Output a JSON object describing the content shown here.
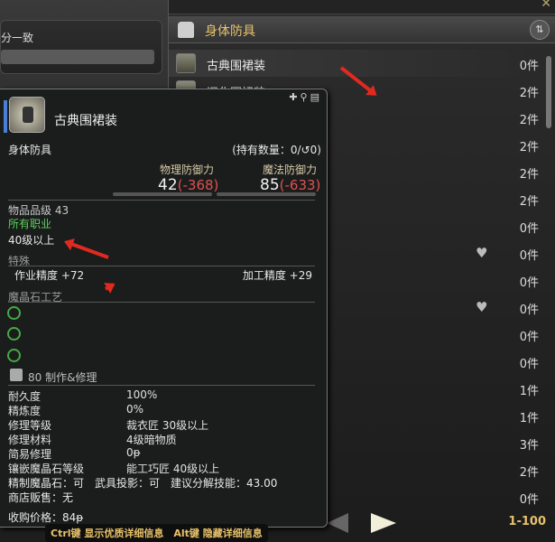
{
  "left_panel": {
    "filter_label": "分一致"
  },
  "list_header": {
    "category": "身体防具"
  },
  "items": [
    {
      "name": "古典围裙装",
      "qty": "0件",
      "heart": false
    },
    {
      "name": "旧化围裙装",
      "qty": "2件",
      "heart": false
    },
    {
      "name": "",
      "qty": "2件",
      "heart": false
    },
    {
      "name": "",
      "qty": "2件",
      "heart": false
    },
    {
      "name": "",
      "qty": "2件",
      "heart": false
    },
    {
      "name": "",
      "qty": "2件",
      "heart": false
    },
    {
      "name": "",
      "qty": "0件",
      "heart": false
    },
    {
      "name": "",
      "qty": "0件",
      "heart": true
    },
    {
      "name": "",
      "qty": "0件",
      "heart": false
    },
    {
      "name": "",
      "qty": "0件",
      "heart": true
    },
    {
      "name": "",
      "qty": "0件",
      "heart": false
    },
    {
      "name": "",
      "qty": "0件",
      "heart": false
    },
    {
      "name": "",
      "qty": "1件",
      "heart": false
    },
    {
      "name": "",
      "qty": "1件",
      "heart": false
    },
    {
      "name": "",
      "qty": "3件",
      "heart": false
    },
    {
      "name": "",
      "qty": "2件",
      "heart": false
    },
    {
      "name": "",
      "qty": "0件",
      "heart": false
    }
  ],
  "footer": {
    "page_range": "1-100"
  },
  "tooltip": {
    "name": "古典围裙装",
    "category": "身体防具",
    "owned": "(持有数量：0/",
    "owned_hq": "0)",
    "phys_def_label": "物理防御力",
    "phys_def": "42",
    "phys_def_diff": "(-368)",
    "mag_def_label": "魔法防御力",
    "mag_def": "85",
    "mag_def_diff": "(-633)",
    "item_level": "物品品级 43",
    "jobs": "所有职业",
    "level_req": "40级以上",
    "special_header": "特殊",
    "craftsmanship": "作业精度 +72",
    "control": "加工精度 +29",
    "materia_header": "魔晶石工艺",
    "repair_header": "80 制作&修理",
    "details": [
      {
        "k": "耐久度",
        "v": "100%"
      },
      {
        "k": "精炼度",
        "v": "0%"
      },
      {
        "k": "修理等级",
        "v": "裁衣匠 30级以上"
      },
      {
        "k": "修理材料",
        "v": "4级暗物质"
      },
      {
        "k": "简易修理",
        "v": "0ᵽ"
      },
      {
        "k": "镶嵌魔晶石等级",
        "v": "能工巧匠 40级以上"
      }
    ],
    "extra": "精制魔晶石：可　武具投影：可　建议分解技能：43.00",
    "shop": "商店贩售：无",
    "price": "收购价格：84ᵽ"
  },
  "hint": "Ctrl键 显示优质详细信息　Alt键 隐藏详细信息",
  "colors": {
    "accent_gold": "#e8c26a",
    "green": "#5cd05c",
    "red": "#e05050",
    "annotation": "#e02a20"
  }
}
